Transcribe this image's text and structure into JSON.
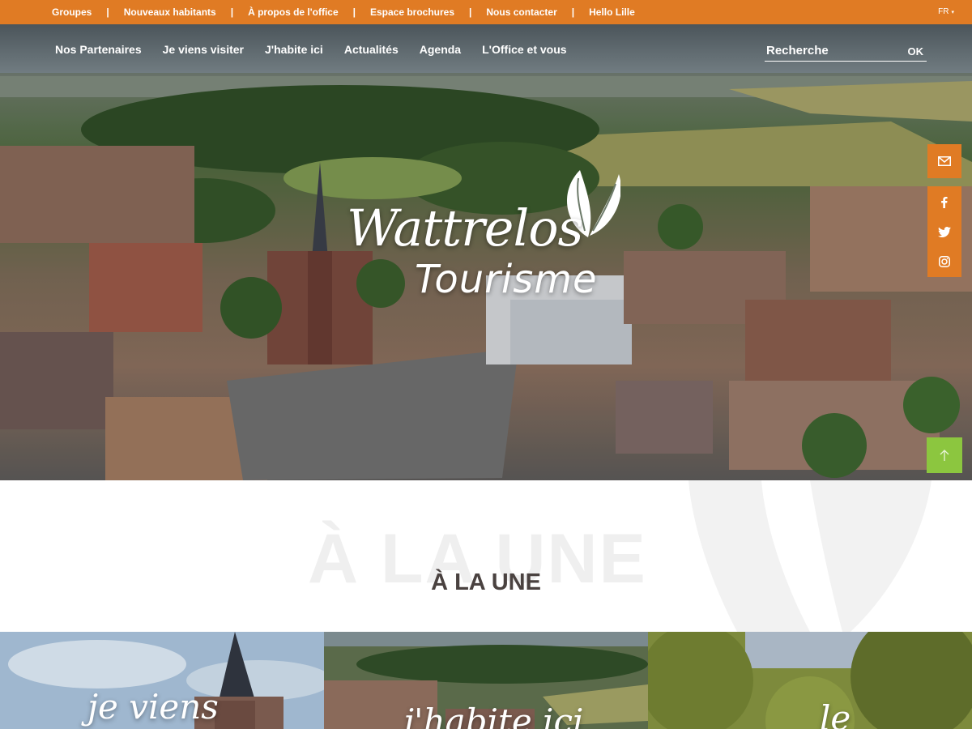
{
  "topbar": {
    "links": [
      "Groupes",
      "Nouveaux habitants",
      "À propos de l'office",
      "Espace brochures",
      "Nous contacter",
      "Hello Lille"
    ],
    "separator": "|",
    "language": "FR",
    "color": "#e07b24"
  },
  "nav": {
    "items": [
      "Nos Partenaires",
      "Je viens visiter",
      "J'habite ici",
      "Actualités",
      "Agenda",
      "L'Office et vous"
    ]
  },
  "search": {
    "placeholder": "Recherche",
    "button": "OK"
  },
  "logo": {
    "line1": "Wattrelos",
    "line2": "Tourisme"
  },
  "social": {
    "icons": [
      "mail-icon",
      "facebook-icon",
      "twitter-icon",
      "instagram-icon"
    ],
    "color": "#e07b24"
  },
  "scroll_top": {
    "icon": "arrow-up-icon",
    "color": "#8cc63f"
  },
  "une": {
    "ghost": "À LA UNE",
    "title": "À LA UNE"
  },
  "cards": [
    {
      "title": "je viens"
    },
    {
      "title": "j'habite ici"
    },
    {
      "title": "le"
    }
  ]
}
